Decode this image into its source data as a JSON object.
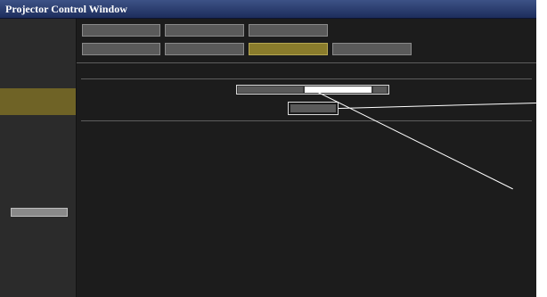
{
  "window": {
    "title": "Projector Control Window"
  },
  "sidebar": {
    "items": [
      {
        "label": "",
        "active": false
      },
      {
        "label": "",
        "active": false
      },
      {
        "label": "",
        "active": true
      },
      {
        "label": "",
        "active": false
      },
      {
        "label": "",
        "active": false
      }
    ],
    "button_label": ""
  },
  "tabs": {
    "row1": [
      {
        "label": "",
        "active": false
      },
      {
        "label": "",
        "active": false
      },
      {
        "label": "",
        "active": false
      }
    ],
    "row2": [
      {
        "label": "",
        "active": false
      },
      {
        "label": "",
        "active": false
      },
      {
        "label": "",
        "active": true
      },
      {
        "label": "",
        "active": false
      }
    ]
  },
  "form": {
    "field_label": "",
    "field_value": "",
    "send_label": ""
  },
  "colors": {
    "title_bar": "#1d2d5c",
    "active_accent": "#8a7c2c",
    "background": "#1c1c1c"
  }
}
